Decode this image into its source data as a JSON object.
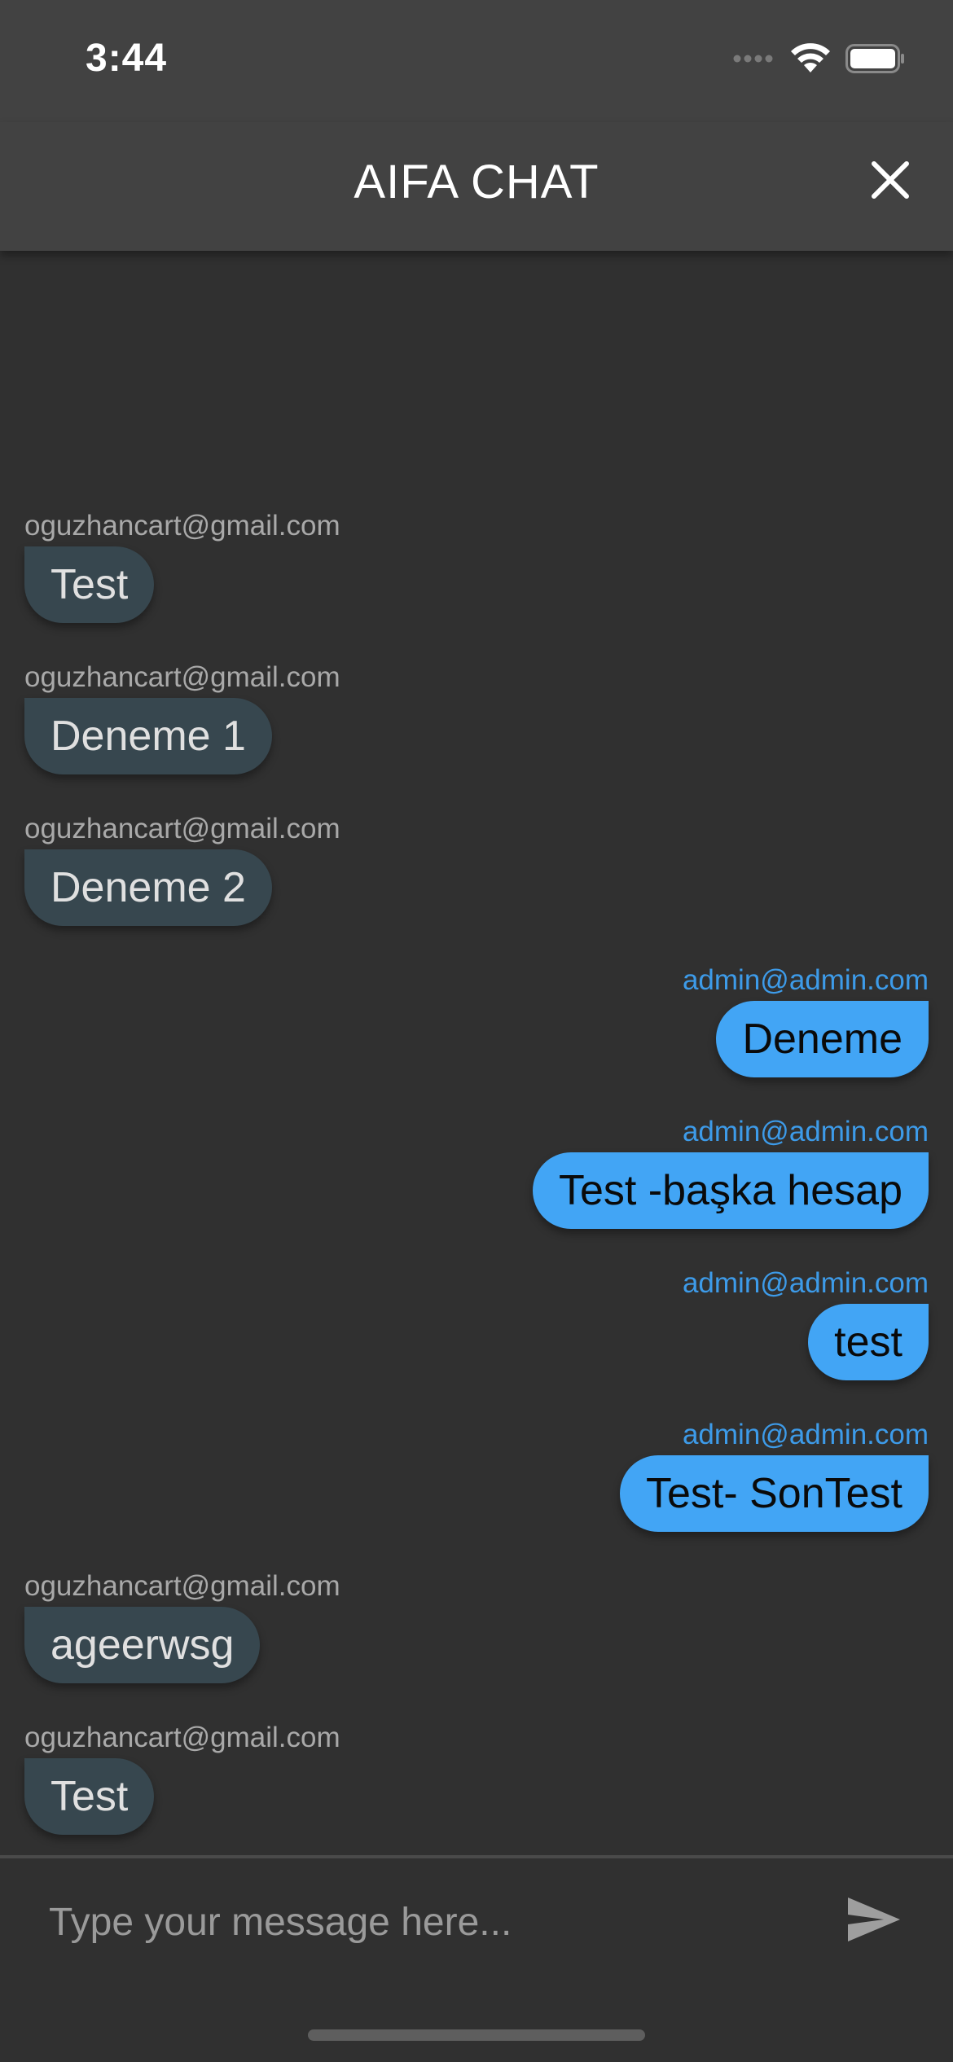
{
  "status_bar": {
    "time": "3:44"
  },
  "header": {
    "title": "AIFA CHAT",
    "close_icon": "close-icon"
  },
  "messages": [
    {
      "sender": "oguzhancart@gmail.com",
      "text": "Test",
      "mine": false
    },
    {
      "sender": "oguzhancart@gmail.com",
      "text": "Deneme 1",
      "mine": false
    },
    {
      "sender": "oguzhancart@gmail.com",
      "text": "Deneme 2",
      "mine": false
    },
    {
      "sender": "admin@admin.com",
      "text": "Deneme",
      "mine": true
    },
    {
      "sender": "admin@admin.com",
      "text": "Test -başka hesap",
      "mine": true
    },
    {
      "sender": "admin@admin.com",
      "text": "test",
      "mine": true
    },
    {
      "sender": "admin@admin.com",
      "text": "Test- SonTest",
      "mine": true
    },
    {
      "sender": "oguzhancart@gmail.com",
      "text": "ageerwsg",
      "mine": false
    },
    {
      "sender": "oguzhancart@gmail.com",
      "text": "Test",
      "mine": false
    }
  ],
  "composer": {
    "value": "",
    "placeholder": "Type your message here...",
    "send_icon": "send-icon"
  },
  "colors": {
    "app_bar": "#424242",
    "background": "#303030",
    "incoming_bubble": "#37474f",
    "outgoing_bubble": "#42a5f5",
    "outgoing_sender": "#3d9be9"
  }
}
